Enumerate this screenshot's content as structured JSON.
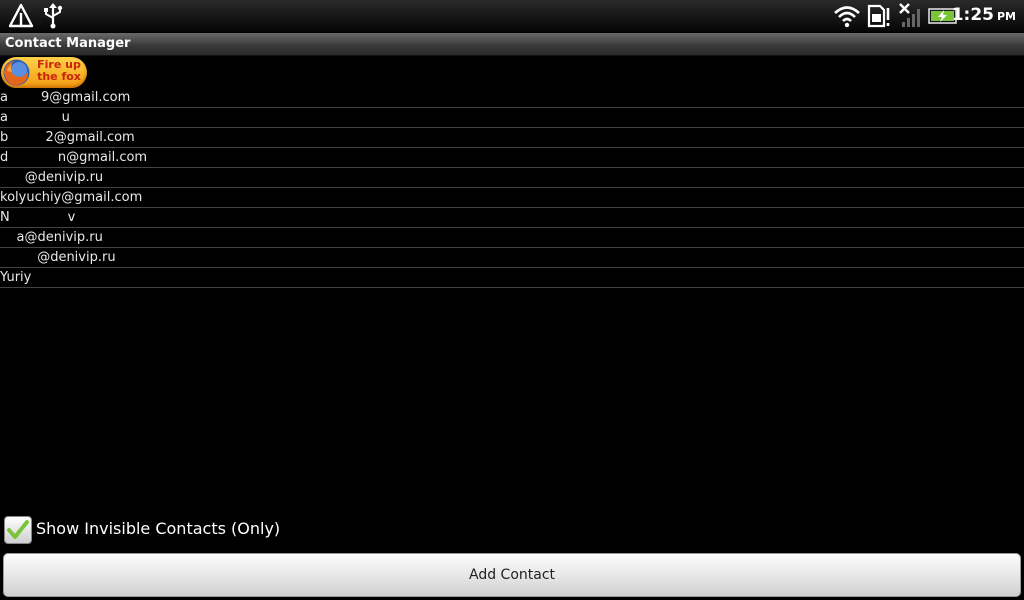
{
  "status_bar": {
    "time": "1:25",
    "ampm": "PM",
    "icons": [
      "alert-icon",
      "usb-icon",
      "wifi-icon",
      "sim-alert-icon",
      "no-signal-icon",
      "battery-charging-icon"
    ]
  },
  "title_bar": {
    "title": "Contact Manager"
  },
  "banner": {
    "text": "Fire up the fox",
    "icon": "firefox-icon"
  },
  "contacts": [
    "a        9@gmail.com",
    "a             u",
    "b         2@gmail.com",
    "d            n@gmail.com",
    "      @denivip.ru",
    "kolyuchiy@gmail.com",
    "N              v",
    "    a@denivip.ru",
    "         @denivip.ru",
    "Yuriy"
  ],
  "show_invisible": {
    "label": "Show Invisible Contacts (Only)",
    "checked": true
  },
  "add_button": {
    "label": "Add Contact"
  },
  "colors": {
    "background": "#000000",
    "accent_green": "#7cc43a",
    "banner_orange": "#f39a10"
  }
}
